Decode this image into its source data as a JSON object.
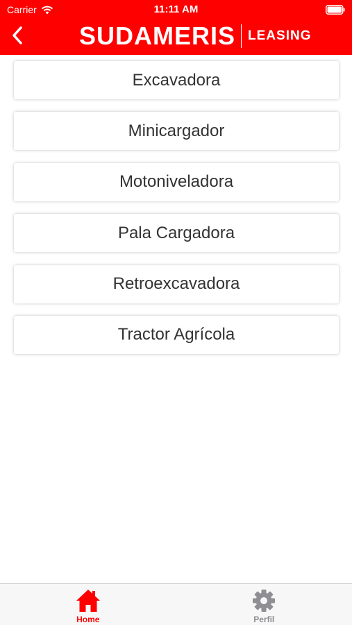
{
  "colors": {
    "brand": "#ff0000",
    "inactive": "#8e8e93",
    "item_text": "#333333"
  },
  "status_bar": {
    "carrier": "Carrier",
    "time": "11:11 AM",
    "wifi_icon": "wifi-icon",
    "battery_icon": "battery-icon"
  },
  "header": {
    "back_icon": "chevron-left-icon",
    "logo_main": "SUDAMERIS",
    "logo_sub": "LEASING"
  },
  "categories": [
    {
      "label": "Excavadora"
    },
    {
      "label": "Minicargador"
    },
    {
      "label": "Motoniveladora"
    },
    {
      "label": "Pala Cargadora"
    },
    {
      "label": "Retroexcavadora"
    },
    {
      "label": "Tractor Agrícola"
    }
  ],
  "tabbar": {
    "home": {
      "label": "Home",
      "icon": "home-icon",
      "active": true
    },
    "profile": {
      "label": "Perfil",
      "icon": "gear-icon",
      "active": false
    }
  }
}
